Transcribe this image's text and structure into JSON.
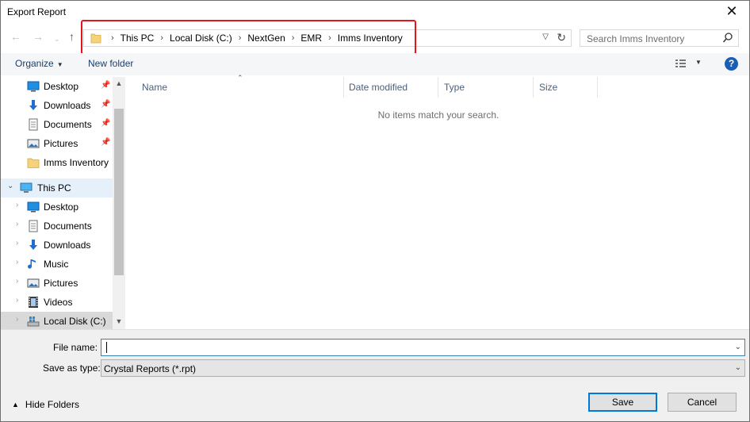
{
  "window": {
    "title": "Export Report"
  },
  "address_bar": {
    "crumbs": [
      "This PC",
      "Local Disk (C:)",
      "NextGen",
      "EMR",
      "Imms Inventory"
    ]
  },
  "search": {
    "placeholder": "Search Imms Inventory"
  },
  "toolbar": {
    "organize_label": "Organize",
    "new_folder_label": "New folder",
    "help_label": "?"
  },
  "nav_pane": {
    "quick_access": [
      {
        "label": "Desktop",
        "icon": "desktop-icon",
        "pinned": true
      },
      {
        "label": "Downloads",
        "icon": "downloads-icon",
        "pinned": true
      },
      {
        "label": "Documents",
        "icon": "documents-icon",
        "pinned": true
      },
      {
        "label": "Pictures",
        "icon": "pictures-icon",
        "pinned": true
      },
      {
        "label": "Imms Inventory",
        "icon": "folder-icon",
        "pinned": false
      }
    ],
    "this_pc_label": "This PC",
    "this_pc_items": [
      {
        "label": "Desktop",
        "icon": "desktop-icon"
      },
      {
        "label": "Documents",
        "icon": "documents-icon"
      },
      {
        "label": "Downloads",
        "icon": "downloads-icon"
      },
      {
        "label": "Music",
        "icon": "music-icon"
      },
      {
        "label": "Pictures",
        "icon": "pictures-icon"
      },
      {
        "label": "Videos",
        "icon": "videos-icon"
      },
      {
        "label": "Local Disk (C:)",
        "icon": "drive-icon"
      }
    ]
  },
  "file_list": {
    "columns": [
      "Name",
      "Date modified",
      "Type",
      "Size"
    ],
    "empty_message": "No items match your search."
  },
  "form": {
    "file_name_label": "File name:",
    "file_name_value": "",
    "save_as_type_label": "Save as type:",
    "save_as_type_value": "Crystal Reports (*.rpt)"
  },
  "footer": {
    "hide_folders_label": "Hide Folders",
    "save_label": "Save",
    "cancel_label": "Cancel"
  },
  "colors": {
    "highlight_box": "#e3141c",
    "primary_button_border": "#0078d7",
    "link_text": "#1b3d6e"
  }
}
